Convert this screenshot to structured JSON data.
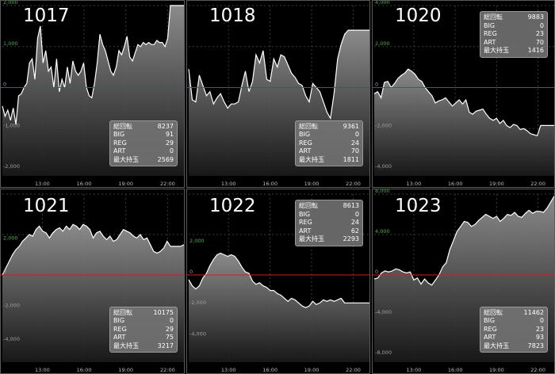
{
  "colors": {
    "background": "#000000",
    "grid": "#3a3a3a",
    "zero_line": "#d81c1c",
    "line": "#ffffff",
    "axis_text_positive": "#4caf50",
    "axis_text_negative": "#9e9e9e",
    "time_text": "#bdbdbd",
    "box_bg": "#808080"
  },
  "stat_labels": [
    "総回転",
    "BIG",
    "REG",
    "ART",
    "最大持玉"
  ],
  "chart_data": [
    {
      "type": "area",
      "title": "1017",
      "x_ticks": [
        "13:00",
        "16:00",
        "19:00",
        "22:00"
      ],
      "y_ticks": [
        "2,000",
        "1,000",
        "0",
        "-1,000",
        "-2,000"
      ],
      "ylim": [
        -2000,
        2000
      ],
      "stats": {
        "総回転": "8237",
        "BIG": "91",
        "REG": "29",
        "ART": "0",
        "最大持玉": "2569"
      },
      "series": [
        {
          "values": [
            -450,
            -700,
            -550,
            -800,
            -500,
            -900,
            -200,
            -150,
            0,
            100,
            600,
            700,
            200,
            1200,
            1500,
            600,
            900,
            400,
            500,
            0,
            700,
            -100,
            200,
            0,
            500,
            100,
            650,
            400,
            300,
            400,
            600,
            0,
            -200,
            -250,
            100,
            600,
            1300,
            1050,
            900,
            650,
            400,
            300,
            500,
            900,
            800,
            1000,
            1250,
            750,
            650,
            850,
            1050,
            1000,
            1100,
            1050,
            1100,
            1050,
            1050,
            1150,
            1100,
            1100,
            1000,
            1200,
            2000,
            2000,
            2000,
            2000,
            2000,
            2000
          ]
        }
      ]
    },
    {
      "type": "area",
      "title": "1018",
      "x_ticks": [
        "13:00",
        "16:00",
        "19:00",
        "22:00"
      ],
      "y_ticks": [],
      "ylim": [
        -2000,
        2000
      ],
      "stats": {
        "総回転": "9361",
        "BIG": "0",
        "REG": "24",
        "ART": "70",
        "最大持玉": "1811"
      },
      "series": [
        {
          "values": [
            450,
            -300,
            -350,
            300,
            50,
            -200,
            -100,
            -400,
            -250,
            -150,
            -350,
            -500,
            -400,
            -400,
            -350,
            50,
            400,
            -100,
            150,
            800,
            600,
            900,
            200,
            150,
            700,
            500,
            800,
            750,
            550,
            350,
            250,
            100,
            50,
            -200,
            -350,
            100,
            0,
            -100,
            -350,
            -600,
            -750,
            -150,
            700,
            1050,
            1300,
            1400,
            1400,
            1400,
            1400,
            1400,
            1400,
            1400
          ]
        }
      ]
    },
    {
      "type": "area",
      "title": "1020",
      "x_ticks": [
        "13:00",
        "16:00",
        "19:00",
        "22:00"
      ],
      "y_ticks": [
        "4,000",
        "2,000",
        "0",
        "-2,000",
        "-4,000"
      ],
      "ylim": [
        -4000,
        4000
      ],
      "stats": {
        "総回転": "9883",
        "BIG": "0",
        "REG": "23",
        "ART": "70",
        "最大持玉": "1416"
      },
      "series": [
        {
          "values": [
            -300,
            -200,
            -500,
            250,
            300,
            0,
            200,
            450,
            600,
            700,
            900,
            800,
            650,
            400,
            300,
            0,
            -200,
            -400,
            -750,
            -650,
            -600,
            -500,
            -700,
            -900,
            -750,
            -600,
            -800,
            -600,
            -1200,
            -1300,
            -1150,
            -1100,
            -1050,
            -1300,
            -1500,
            -1600,
            -1500,
            -1750,
            -1600,
            -1850,
            -1950,
            -1800,
            -1850,
            -2050,
            -2000,
            -2100,
            -2250,
            -2300,
            -2350,
            -1850,
            -1850,
            -1850,
            -1850,
            -1850
          ]
        }
      ]
    },
    {
      "type": "area",
      "title": "1021",
      "x_ticks": [
        "13:00",
        "16:00",
        "19:00",
        "22:00"
      ],
      "y_ticks": [
        "2,000",
        "0",
        "-2,000",
        "-4,000"
      ],
      "ylim": [
        -4800,
        4800
      ],
      "stats": {
        "総回転": "10175",
        "BIG": "0",
        "REG": "29",
        "ART": "75",
        "最大持玉": "3217"
      },
      "series": [
        {
          "values": [
            0,
            400,
            800,
            1200,
            1500,
            1700,
            2000,
            2200,
            2400,
            2300,
            2700,
            2900,
            2600,
            2500,
            2200,
            2500,
            2700,
            2800,
            2600,
            2900,
            2700,
            3000,
            2900,
            2700,
            3000,
            2900,
            2700,
            2200,
            2500,
            2600,
            2300,
            2100,
            2300,
            2000,
            2100,
            2400,
            2700,
            2600,
            2500,
            2300,
            2200,
            2400,
            2100,
            2200,
            1800,
            1400,
            1300,
            1400,
            1600,
            2000,
            1700,
            1700,
            1700,
            1700,
            1800
          ]
        }
      ]
    },
    {
      "type": "area",
      "title": "1022",
      "x_ticks": [
        "13:00",
        "16:00",
        "19:00",
        "22:00"
      ],
      "y_ticks": [
        "2,000",
        "0",
        "-2,000",
        "-4,000"
      ],
      "ylim": [
        -5200,
        5200
      ],
      "stats": {
        "総回転": "8613",
        "BIG": "0",
        "REG": "24",
        "ART": "62",
        "最大持玉": "2293"
      },
      "series": [
        {
          "values": [
            -300,
            -700,
            -900,
            -700,
            -200,
            100,
            600,
            1000,
            1300,
            1400,
            1300,
            1200,
            1300,
            1200,
            900,
            500,
            200,
            100,
            -400,
            -600,
            -500,
            -700,
            -800,
            -1000,
            -1000,
            -1200,
            -1300,
            -1500,
            -1700,
            -1500,
            -1600,
            -1800,
            -2000,
            -2100,
            -2000,
            -1700,
            -1900,
            -1800,
            -1600,
            -1700,
            -1600,
            -1700,
            -1600,
            -1500,
            -1800,
            -1800,
            -1800,
            -1800,
            -1800,
            -1800,
            -1800,
            -1800
          ]
        }
      ]
    },
    {
      "type": "area",
      "title": "1023",
      "x_ticks": [
        "13:00",
        "16:00",
        "19:00",
        "22:00"
      ],
      "y_ticks": [
        "8,000",
        "4,000",
        "0",
        "-4,000",
        "-8,000"
      ],
      "ylim": [
        -8000,
        8000
      ],
      "stats": {
        "総回転": "11462",
        "BIG": "0",
        "REG": "23",
        "ART": "93",
        "最大持玉": "7823"
      },
      "series": [
        {
          "values": [
            -400,
            -300,
            200,
            400,
            300,
            400,
            600,
            500,
            300,
            200,
            300,
            -500,
            -300,
            -900,
            -400,
            -800,
            -1000,
            -500,
            0,
            800,
            1200,
            2500,
            3400,
            4300,
            4800,
            5300,
            5200,
            4800,
            5000,
            5400,
            5700,
            6000,
            5800,
            5600,
            5800,
            5300,
            5600,
            6000,
            5900,
            6200,
            5800,
            5700,
            6100,
            6400,
            6100,
            6300,
            6300,
            6200,
            6600,
            7200,
            7800
          ]
        }
      ]
    }
  ]
}
